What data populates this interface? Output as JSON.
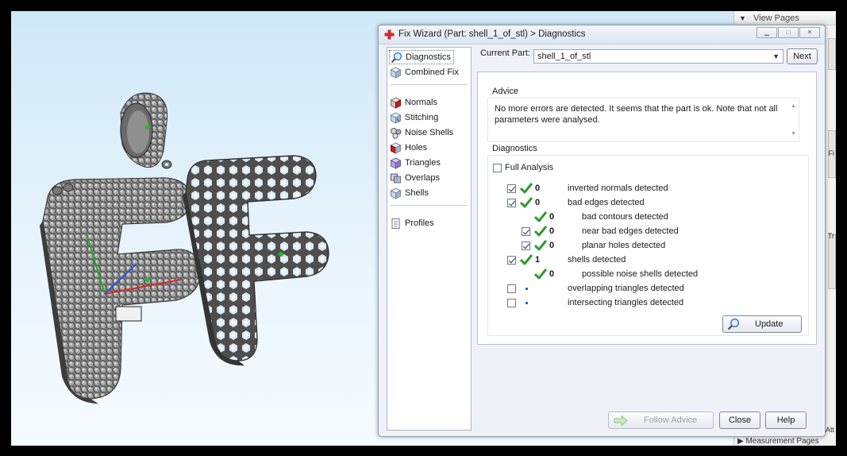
{
  "right_panel": {
    "view_pages": "View Pages",
    "bottom_partial": "Measurement Pages",
    "side_fragments": [
      "Fi",
      "Tr",
      "Att"
    ]
  },
  "dialog": {
    "title": "Fix Wizard (Part: shell_1_of_stl) > Diagnostics",
    "left_list": {
      "items": [
        {
          "label": "Diagnostics",
          "icon": "magnifier-icon",
          "selected": true
        },
        {
          "label": "Combined Fix",
          "icon": "cube-icon"
        },
        {
          "label": "Normals",
          "icon": "normals-cube-icon"
        },
        {
          "label": "Stitching",
          "icon": "stitching-cube-icon"
        },
        {
          "label": "Noise Shells",
          "icon": "noise-shells-icon"
        },
        {
          "label": "Holes",
          "icon": "holes-cube-icon"
        },
        {
          "label": "Triangles",
          "icon": "triangles-icon"
        },
        {
          "label": "Overlaps",
          "icon": "overlaps-icon"
        },
        {
          "label": "Shells",
          "icon": "shells-icon"
        },
        {
          "label": "Profiles",
          "icon": "profiles-icon"
        }
      ]
    },
    "current_part": {
      "label": "Current Part:",
      "value": "shell_1_of_stl"
    },
    "next_button": "Next",
    "advice": {
      "label": "Advice",
      "text": "No more errors are detected. It seems that the part is ok. Note that not all parameters were analysed."
    },
    "diagnostics": {
      "label": "Diagnostics",
      "full_analysis": {
        "label": "Full Analysis",
        "checked": false
      },
      "rows": [
        {
          "checkbox": true,
          "checked": true,
          "status": "ok",
          "count": "0",
          "label": "inverted normals detected",
          "indent": 0
        },
        {
          "checkbox": true,
          "checked": true,
          "status": "ok",
          "count": "0",
          "label": "bad edges detected",
          "indent": 0
        },
        {
          "checkbox": false,
          "checked": false,
          "status": "ok",
          "count": "0",
          "label": "bad contours detected",
          "indent": 1
        },
        {
          "checkbox": true,
          "checked": true,
          "status": "ok",
          "count": "0",
          "label": "near bad edges detected",
          "indent": 1
        },
        {
          "checkbox": true,
          "checked": true,
          "status": "ok",
          "count": "0",
          "label": "planar holes detected",
          "indent": 1
        },
        {
          "checkbox": true,
          "checked": true,
          "status": "ok",
          "count": "1",
          "label": "shells detected",
          "indent": 0
        },
        {
          "checkbox": false,
          "checked": false,
          "status": "ok",
          "count": "0",
          "label": "possible noise shells detected",
          "indent": 1
        },
        {
          "checkbox": true,
          "checked": false,
          "status": "pending",
          "count": "",
          "label": "overlapping triangles detected",
          "indent": 0
        },
        {
          "checkbox": true,
          "checked": false,
          "status": "pending",
          "count": "",
          "label": "intersecting triangles detected",
          "indent": 0
        }
      ],
      "update_button": "Update"
    },
    "footer": {
      "follow_advice": "Follow Advice",
      "close": "Close",
      "help": "Help"
    }
  },
  "colors": {
    "accent_green": "#2e9a2e",
    "dialog_bg": "#eef2f8",
    "pending_dot": "#1f4fbf",
    "red_cross": "#d42a2a"
  }
}
